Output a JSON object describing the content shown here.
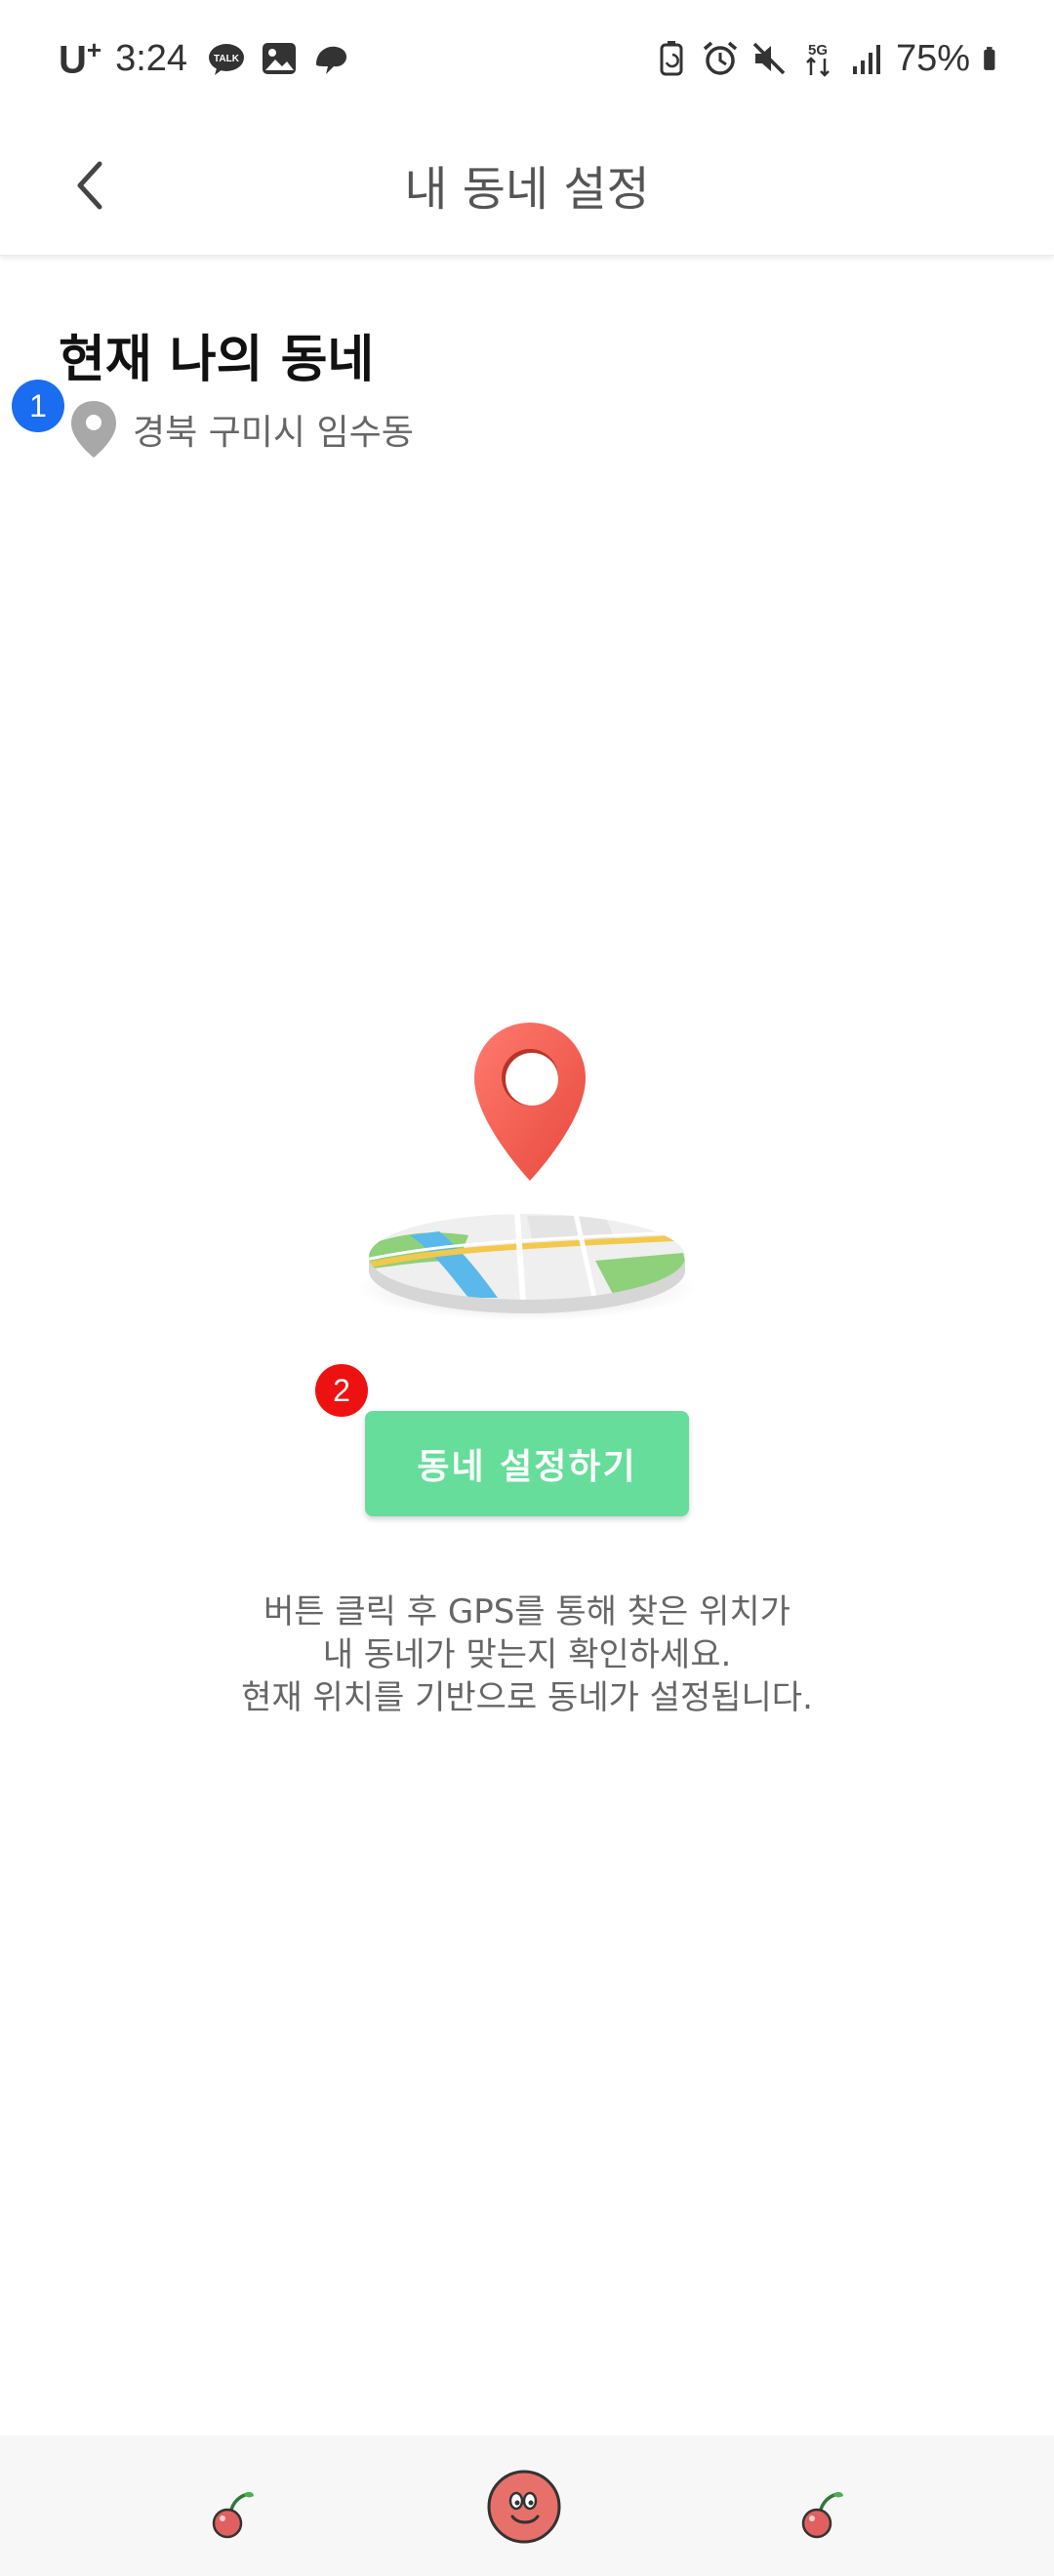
{
  "status_bar": {
    "carrier": "U",
    "carrier_sup": "+",
    "time": "3:24",
    "battery": "75%",
    "network": "5G",
    "left_icons": [
      "kakaotalk-icon",
      "gallery-icon",
      "messenger-icon"
    ],
    "right_icons": [
      "battery-saver-icon",
      "alarm-icon",
      "mute-icon",
      "5g-icon",
      "signal-icon",
      "battery-icon"
    ]
  },
  "header": {
    "title": "내 동네 설정",
    "back_icon": "chevron-left-icon"
  },
  "current_area": {
    "title": "현재 나의 동네",
    "location": "경북 구미시 임수동",
    "location_icon": "map-pin-icon"
  },
  "badges": {
    "first": "1",
    "second": "2"
  },
  "action": {
    "button_label": "동네 설정하기"
  },
  "description": {
    "line1": "버튼 클릭 후 GPS를 통해 찾은 위치가",
    "line2": "내 동네가 맞는지 확인하세요.",
    "line3": "현재 위치를 기반으로 동네가 설정됩니다."
  },
  "bottom_nav": {
    "items": [
      "cherry-icon",
      "mascot-icon",
      "cherry-icon"
    ]
  },
  "colors": {
    "accent_green": "#66dd9a",
    "pin_red": "#f25f55",
    "badge_blue": "#1a6cf0",
    "badge_red": "#ee1111"
  }
}
